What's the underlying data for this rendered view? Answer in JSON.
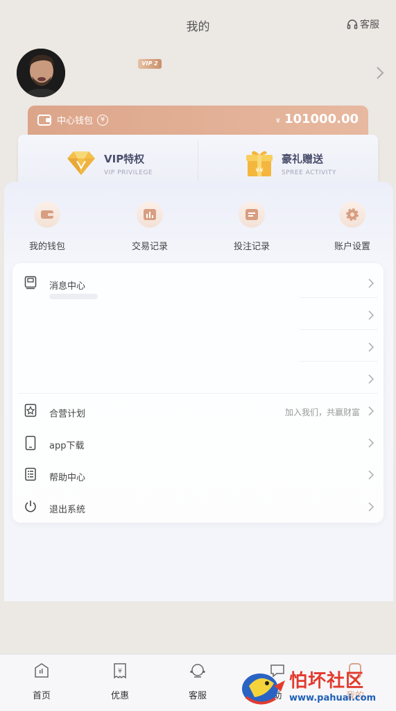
{
  "header": {
    "title": "我的",
    "service_label": "客服"
  },
  "profile": {
    "vip_level": "VIP 2"
  },
  "wallet": {
    "label": "中心钱包",
    "currency_symbol": "¥",
    "amount": "101000.00"
  },
  "vip_cards": [
    {
      "title": "VIP特权",
      "subtitle": "VIP PRIVILEGE",
      "icon": "diamond-icon"
    },
    {
      "title": "豪礼赠送",
      "subtitle": "SPREE ACTIVITY",
      "icon": "gift-icon"
    }
  ],
  "quick_actions": [
    {
      "label": "我的钱包",
      "icon": "wallet-icon"
    },
    {
      "label": "交易记录",
      "icon": "chart-icon"
    },
    {
      "label": "投注记录",
      "icon": "record-icon"
    },
    {
      "label": "账户设置",
      "icon": "gear-icon"
    }
  ],
  "menu": {
    "message_center": "消息中心",
    "partnership": "合营计划",
    "partnership_extra": "加入我们，共赢财富",
    "app_download": "app下载",
    "help_center": "帮助中心",
    "logout": "退出系统"
  },
  "tabbar": [
    {
      "label": "首页",
      "icon": "home-icon"
    },
    {
      "label": "优惠",
      "icon": "coupon-icon"
    },
    {
      "label": "客服",
      "icon": "headset-icon"
    },
    {
      "label": "助",
      "icon": "chat-icon"
    },
    {
      "label": "我的",
      "icon": "user-icon"
    }
  ],
  "watermark": {
    "title": "怕坏社区",
    "url": "www.pahuai.com"
  },
  "colors": {
    "accent": "#d8a58a",
    "wallet_gradient_start": "#dca58a",
    "wallet_gradient_end": "#e7b9a0",
    "text_dark": "#444444",
    "watermark_red": "#e23b2e",
    "watermark_blue": "#1f5fb5"
  }
}
